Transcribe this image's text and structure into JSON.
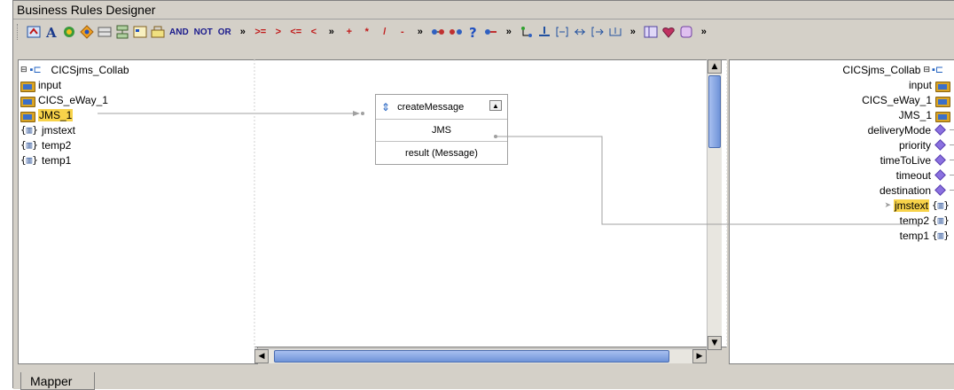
{
  "window": {
    "title": "Business Rules Designer"
  },
  "toolbar": {
    "ops": [
      "AND",
      "NOT",
      "OR",
      "»",
      ">=",
      ">",
      "<=",
      "<",
      "»",
      "+",
      "*",
      "/",
      "-",
      "»"
    ]
  },
  "left_tree": {
    "root": "CICSjms_Collab",
    "items": [
      {
        "label": "input",
        "type": "folder"
      },
      {
        "label": "CICS_eWay_1",
        "type": "folder"
      },
      {
        "label": "JMS_1",
        "type": "folder",
        "selected": true
      },
      {
        "label": "jmstext",
        "type": "var"
      },
      {
        "label": "temp2",
        "type": "var"
      },
      {
        "label": "temp1",
        "type": "var"
      }
    ]
  },
  "method_box": {
    "title": "createMessage",
    "input": "JMS",
    "output": "result (Message)"
  },
  "right_tree": {
    "root": "CICSjms_Collab",
    "items": [
      {
        "label": "input",
        "type": "folder"
      },
      {
        "label": "CICS_eWay_1",
        "type": "folder"
      },
      {
        "label": "JMS_1",
        "type": "folder"
      },
      {
        "label": "deliveryMode",
        "type": "prop"
      },
      {
        "label": "priority",
        "type": "prop"
      },
      {
        "label": "timeToLive",
        "type": "prop"
      },
      {
        "label": "timeout",
        "type": "prop"
      },
      {
        "label": "destination",
        "type": "prop"
      },
      {
        "label": "jmstext",
        "type": "var",
        "selected": true
      },
      {
        "label": "temp2",
        "type": "var"
      },
      {
        "label": "temp1",
        "type": "var"
      }
    ]
  },
  "tabs": [
    {
      "label": "Mapper",
      "active": true
    }
  ],
  "colors": {
    "selection": "#f8d34a",
    "link": "#a0a0a0",
    "scroll_thumb": "#6f93d8"
  }
}
